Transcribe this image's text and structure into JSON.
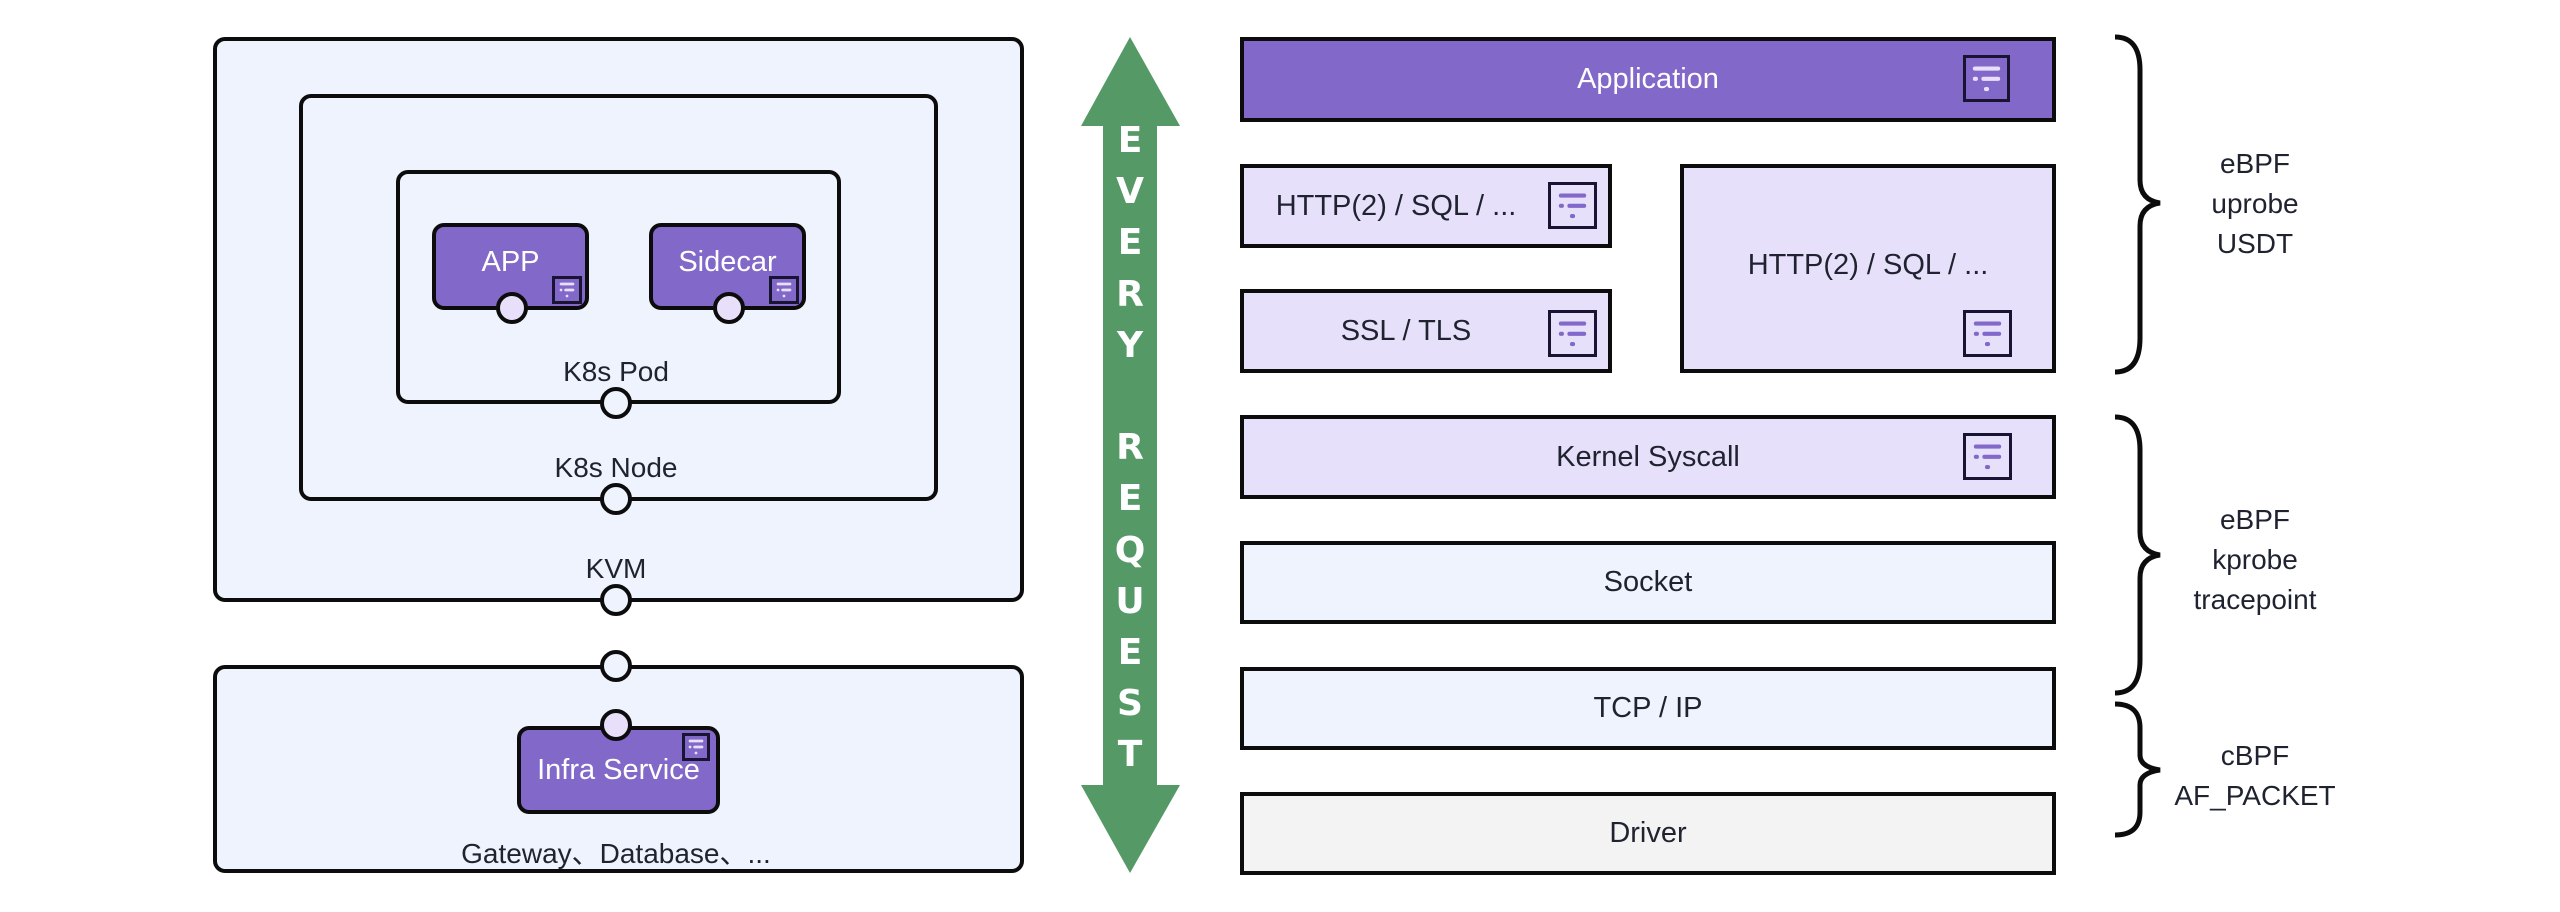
{
  "colors": {
    "component_purple": "#8268c8",
    "frame_blue": "#eef3fd",
    "layer_lavender": "#e7e0fb",
    "layer_grey": "#f3f3f3",
    "arrow_green": "#559966"
  },
  "left": {
    "kvm_label": "KVM",
    "node_label": "K8s Node",
    "pod_label": "K8s Pod",
    "app_label": "APP",
    "sidecar_label": "Sidecar",
    "infra_service_label": "Infra Service",
    "infra_caption": "Gateway、Database、..."
  },
  "arrow": {
    "letters": [
      "E",
      "V",
      "E",
      "R",
      "Y",
      " ",
      "R",
      "E",
      "Q",
      "U",
      "E",
      "S",
      "T"
    ],
    "text": "EVERY REQUEST"
  },
  "layers": {
    "application": "Application",
    "http_small": "HTTP(2) / SQL / ...",
    "ssl": "SSL / TLS",
    "http_big": "HTTP(2) / SQL / ...",
    "kernel": "Kernel Syscall",
    "socket": "Socket",
    "tcp": "TCP / IP",
    "driver": "Driver"
  },
  "braces": [
    {
      "lines": [
        "eBPF",
        "uprobe",
        "USDT"
      ]
    },
    {
      "lines": [
        "eBPF",
        "kprobe",
        "tracepoint"
      ]
    },
    {
      "lines": [
        "cBPF",
        "AF_PACKET"
      ]
    }
  ],
  "icons": {
    "probe": "probe-doc-icon"
  }
}
